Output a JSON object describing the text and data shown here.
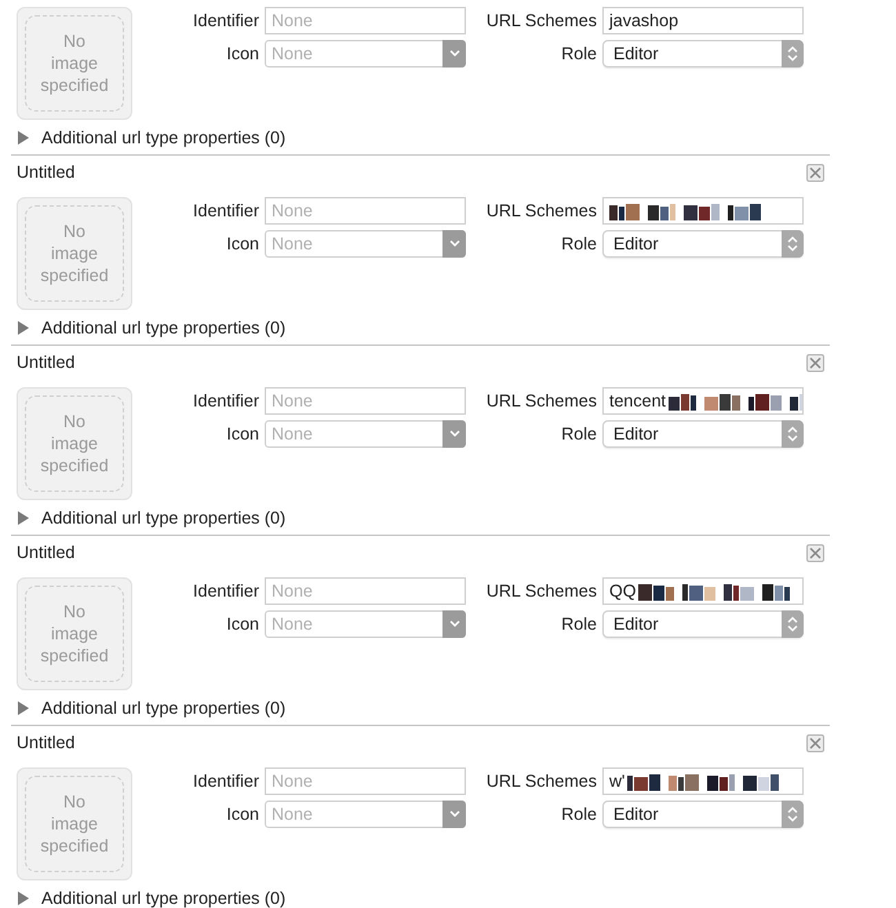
{
  "url_types": [
    {
      "image_well": "No image specified",
      "identifier": {
        "label": "Identifier",
        "placeholder": "None"
      },
      "icon": {
        "label": "Icon",
        "placeholder": "None"
      },
      "url_schemes": {
        "label": "URL Schemes",
        "value": "javashop",
        "redacted": false
      },
      "role": {
        "label": "Role",
        "value": "Editor"
      },
      "additional": {
        "label": "Additional url type properties (0)",
        "expanded": false
      }
    },
    {
      "title": "Untitled",
      "image_well": "No image specified",
      "identifier": {
        "label": "Identifier",
        "placeholder": "None"
      },
      "icon": {
        "label": "Icon",
        "placeholder": "None"
      },
      "url_schemes": {
        "label": "URL Schemes",
        "redacted": true
      },
      "role": {
        "label": "Role",
        "value": "Editor"
      },
      "additional": {
        "label": "Additional url type properties (0)",
        "expanded": false
      }
    },
    {
      "title": "Untitled",
      "image_well": "No image specified",
      "identifier": {
        "label": "Identifier",
        "placeholder": "None"
      },
      "icon": {
        "label": "Icon",
        "placeholder": "None"
      },
      "url_schemes": {
        "label": "URL Schemes",
        "value": "tencent",
        "redacted": true
      },
      "role": {
        "label": "Role",
        "value": "Editor"
      },
      "additional": {
        "label": "Additional url type properties (0)",
        "expanded": false
      }
    },
    {
      "title": "Untitled",
      "image_well": "No image specified",
      "identifier": {
        "label": "Identifier",
        "placeholder": "None"
      },
      "icon": {
        "label": "Icon",
        "placeholder": "None"
      },
      "url_schemes": {
        "label": "URL Schemes",
        "value": "QQ",
        "redacted": true
      },
      "role": {
        "label": "Role",
        "value": "Editor"
      },
      "additional": {
        "label": "Additional url type properties (0)",
        "expanded": false
      }
    },
    {
      "title": "Untitled",
      "image_well": "No image specified",
      "identifier": {
        "label": "Identifier",
        "placeholder": "None"
      },
      "icon": {
        "label": "Icon",
        "placeholder": "None"
      },
      "url_schemes": {
        "label": "URL Schemes",
        "value": "w'",
        "redacted": true
      },
      "role": {
        "label": "Role",
        "value": "Editor"
      },
      "additional": {
        "label": "Additional url type properties (0)",
        "expanded": false
      }
    }
  ]
}
